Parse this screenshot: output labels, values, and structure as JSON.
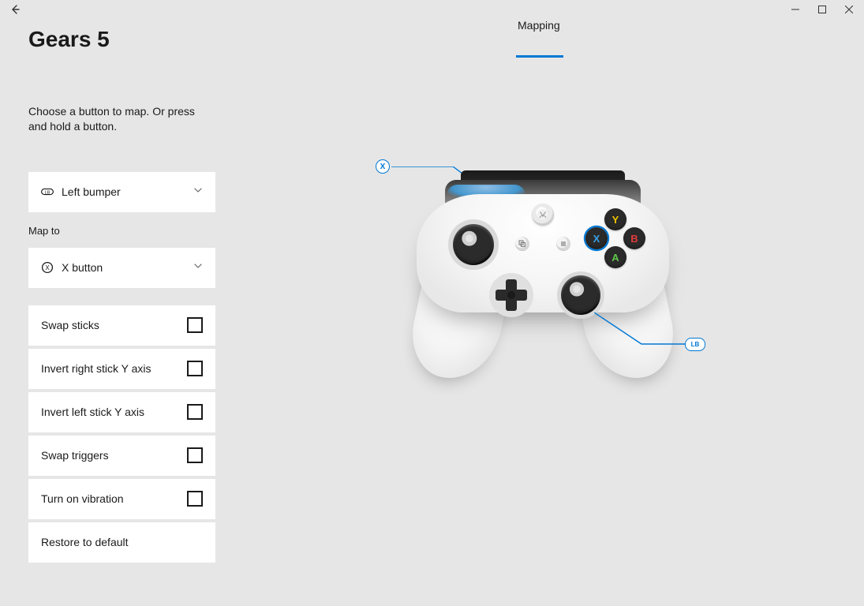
{
  "window": {
    "title": "Gears 5"
  },
  "tabs": {
    "mapping": "Mapping"
  },
  "instruction": "Choose a button to map. Or press and hold a button.",
  "mapto_label": "Map to",
  "dropdowns": {
    "source": {
      "label": "Left bumper"
    },
    "target": {
      "label": "X button"
    }
  },
  "options": {
    "swap_sticks": "Swap sticks",
    "invert_right_y": "Invert right stick Y axis",
    "invert_left_y": "Invert left stick Y axis",
    "swap_triggers": "Swap triggers",
    "vibration": "Turn on vibration"
  },
  "restore": "Restore to default",
  "callouts": {
    "x": "X",
    "lb": "LB"
  },
  "faces": {
    "y": "Y",
    "x": "X",
    "b": "B",
    "a": "A"
  },
  "xbox_glyph": "✕",
  "menu_glyph": "≡",
  "view_glyph": "⧉",
  "colors": {
    "accent": "#0078d4"
  }
}
